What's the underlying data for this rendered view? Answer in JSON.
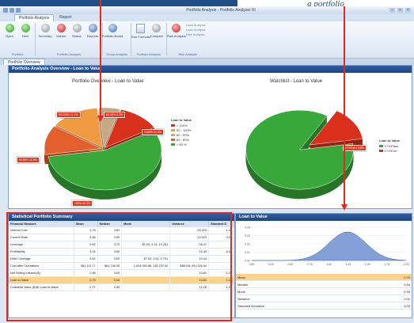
{
  "caption": "a portfolio",
  "window": {
    "title": "Portfolio Analysis - Portfolio Analyzer XI",
    "controls": [
      "–",
      "□",
      "×"
    ]
  },
  "ribbon": {
    "tabs": [
      "Portfolio Analysis",
      "Report"
    ],
    "groups": [
      {
        "label": "Portfolio",
        "buttons": [
          {
            "label": "Open",
            "icon": "open-icon",
            "color": "green"
          },
          {
            "label": "Next",
            "icon": "next-icon",
            "color": "green"
          }
        ]
      },
      {
        "label": "Portfolio Analysis",
        "buttons": [
          {
            "label": "Summary",
            "icon": "summary-icon",
            "color": "gray"
          },
          {
            "label": "Values",
            "icon": "values-icon",
            "color": "red"
          },
          {
            "label": "Ratios",
            "icon": "ratios-icon",
            "color": "gray"
          },
          {
            "label": "Reports",
            "icon": "reports-icon",
            "color": "blue"
          }
        ]
      },
      {
        "label": "Group Analysis",
        "buttons": [
          {
            "label": "Portfolio Board",
            "icon": "board-icon",
            "color": "blue"
          }
        ]
      },
      {
        "label": "Portfolio Analysis",
        "buttons": [
          {
            "label": "Run Forecast",
            "icon": "forecast-icon",
            "color": "doc"
          },
          {
            "label": "Compare",
            "icon": "compare-icon",
            "color": "gray"
          }
        ]
      },
      {
        "label": "Risk Analysis",
        "buttons": [
          {
            "label": "Risk Analysis",
            "icon": "risk-icon",
            "color": "red"
          }
        ],
        "list": [
          "Loan Analysis",
          "Loan Analysis",
          "Risk Analysis"
        ]
      }
    ]
  },
  "document_tab": "Portfolio Overview",
  "overview": {
    "header": "Portfolio Analysis Overview - Loan to Value",
    "left_title": "Portfolio Overview - Loan to Value",
    "right_title": "Watchlist - Loan to Value",
    "left_legend": {
      "title": "Loan to Value",
      "items": [
        {
          "label": "> 100%",
          "color": "#d9301c"
        },
        {
          "label": "90 - 100%",
          "color": "#f09a42"
        },
        {
          "label": "80 - 90%",
          "color": "#c8a882"
        },
        {
          "label": "60 - 80%",
          "color": "#e35f2d"
        },
        {
          "label": "< 60 %",
          "color": "#38a83a"
        }
      ]
    },
    "right_legend": {
      "title": "Loan to Value",
      "items": [
        {
          "label": "LTV/Pass",
          "color": "#38a83a"
        },
        {
          "label": "LTV/Fail",
          "color": "#d9301c"
        }
      ]
    },
    "left_pie": [
      {
        "label": "60-80%",
        "value": 12,
        "color": "#e35f2d"
      },
      {
        "label": "90-100%",
        "value": 14,
        "color": "#f09a42"
      },
      {
        "label": "80-90%",
        "value": 6,
        "color": "#c8a882"
      },
      {
        "label": ">100%",
        "value": 12,
        "color": "#d9301c"
      },
      {
        "label": "<60%",
        "value": 56,
        "color": "#38a83a"
      }
    ],
    "right_pie": [
      {
        "label": "LTV/Pass",
        "value": 86,
        "color": "#38a83a"
      },
      {
        "label": "LTV/Fail",
        "value": 14,
        "color": "#d9301c"
      }
    ],
    "left_tags": [
      "90-100% 11.2%",
      "80-90% 5.3%",
      ">100% 12.4%",
      "60-80% 10.8%",
      "<60% 60.3%"
    ],
    "right_tags": [
      "LTV/Fail 13.6%"
    ]
  },
  "stats": {
    "header": "Statistical Portfolio Summary",
    "columns": [
      "Financial Measure",
      "Mean",
      "Median",
      "Mode",
      "Variance",
      "Standard D"
    ],
    "rows": [
      [
        "Interest Cost",
        "3.78",
        "3.82",
        "",
        "10.223",
        "1.08"
      ],
      [
        "Current Rate",
        "3.48",
        "3.50",
        "",
        "10.223",
        "3.25"
      ],
      [
        "Leverage",
        "5.62",
        "3.70",
        "$2.00, 4.14, 10.251",
        "28.47",
        ""
      ],
      [
        "Profitability",
        "3.24",
        "3.60",
        "",
        "12.44",
        "5.33"
      ],
      [
        "Debt Coverage",
        "3.82",
        "3.62",
        "$7.00, 2.61, 2.791",
        "10.44",
        ""
      ],
      [
        "Cost after Operations",
        "$61,111.77",
        "$61,746.00",
        "1,633,950.88, 126,237.00",
        "$58,911,291,326.40",
        ""
      ],
      [
        "Net Selling Interest ($)",
        "2.88",
        "3.00",
        "",
        "13.81",
        "1.24"
      ],
      [
        "Loan to Value",
        "0.75",
        "0.54",
        "",
        "13.81",
        "1.29"
      ],
      [
        "Collateral Value ($,M) Loan to Value",
        "0.77",
        "0.55",
        "",
        "12.25",
        "1.28"
      ]
    ],
    "highlight_row": 7
  },
  "ltv_panel": {
    "header": "Loan to Value",
    "y_ticks": [
      "0.04",
      "0.03",
      "0.02",
      "0.01",
      "0.00"
    ],
    "x_ticks": [
      "0.00",
      "0.25",
      "0.50",
      "0.75",
      "1.00",
      "1.25",
      "1.50",
      "1.75",
      "2.00"
    ],
    "rows": [
      {
        "label": "Mean",
        "value": "0.75"
      },
      {
        "label": "Median",
        "value": "0.54"
      },
      {
        "label": "Mode",
        "value": "0.55"
      },
      {
        "label": "Variance",
        "value": "0.01"
      },
      {
        "label": "Standard Deviation",
        "value": "0.09"
      }
    ],
    "highlight_row": 0
  }
}
